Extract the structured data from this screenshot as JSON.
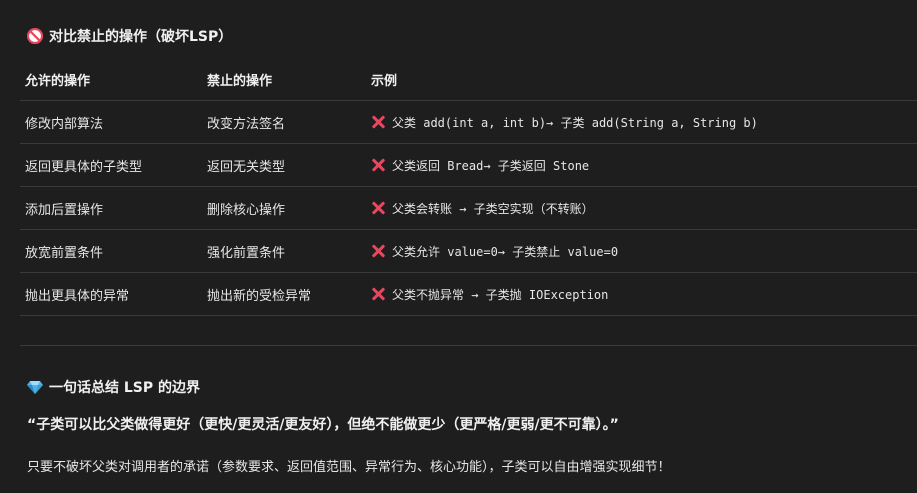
{
  "section1": {
    "icon": "prohibited-icon",
    "title": "对比禁止的操作（破坏LSP）"
  },
  "table": {
    "headers": [
      "允许的操作",
      "禁止的操作",
      "示例"
    ],
    "rows": [
      {
        "allowed": "修改内部算法",
        "forbidden": "改变方法签名",
        "example": "父类 add(int a, int b)→ 子类 add(String a, String b)"
      },
      {
        "allowed": "返回更具体的子类型",
        "forbidden": "返回无关类型",
        "example": "父类返回 Bread→ 子类返回 Stone"
      },
      {
        "allowed": "添加后置操作",
        "forbidden": "删除核心操作",
        "example": "父类会转账 → 子类空实现（不转账）"
      },
      {
        "allowed": "放宽前置条件",
        "forbidden": "强化前置条件",
        "example": "父类允许 value=0→ 子类禁止 value=0"
      },
      {
        "allowed": "抛出更具体的异常",
        "forbidden": "抛出新的受检异常",
        "example": "父类不抛异常 → 子类抛 IOException"
      }
    ],
    "row_icon": "cross-mark-icon"
  },
  "section2": {
    "icon": "gem-icon",
    "title": "一句话总结 LSP 的边界",
    "quote": "“子类可以比父类做得更好（更快/更灵活/更友好），但绝不能做更少（更严格/更弱/更不可靠）。”",
    "note": "只要不破坏父类对调用者的承诺（参数要求、返回值范围、异常行为、核心功能），子类可以自由增强实现细节！"
  },
  "colors": {
    "background": "#1e1e1e",
    "text": "#e6e6e6",
    "cross": "#e8475f",
    "gem": "#4fb3e8",
    "prohibited": "#e8475f"
  }
}
